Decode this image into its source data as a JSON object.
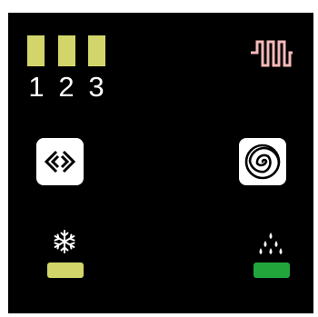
{
  "speed_indicator": {
    "labels": [
      "1",
      "2",
      "3"
    ],
    "bar_color": "#d2d66a"
  },
  "heater_indicator": {
    "icon": "heater-icon",
    "color": "#f4b9b9"
  },
  "mode_button": {
    "icon": "diamond-arrows-icon"
  },
  "fan_button": {
    "icon": "spiral-icon"
  },
  "cool_indicator": {
    "icon": "snowflake-icon",
    "led_color": "#d2d66a"
  },
  "dry_indicator": {
    "icon": "water-drops-icon",
    "led_color": "#22a63c"
  }
}
